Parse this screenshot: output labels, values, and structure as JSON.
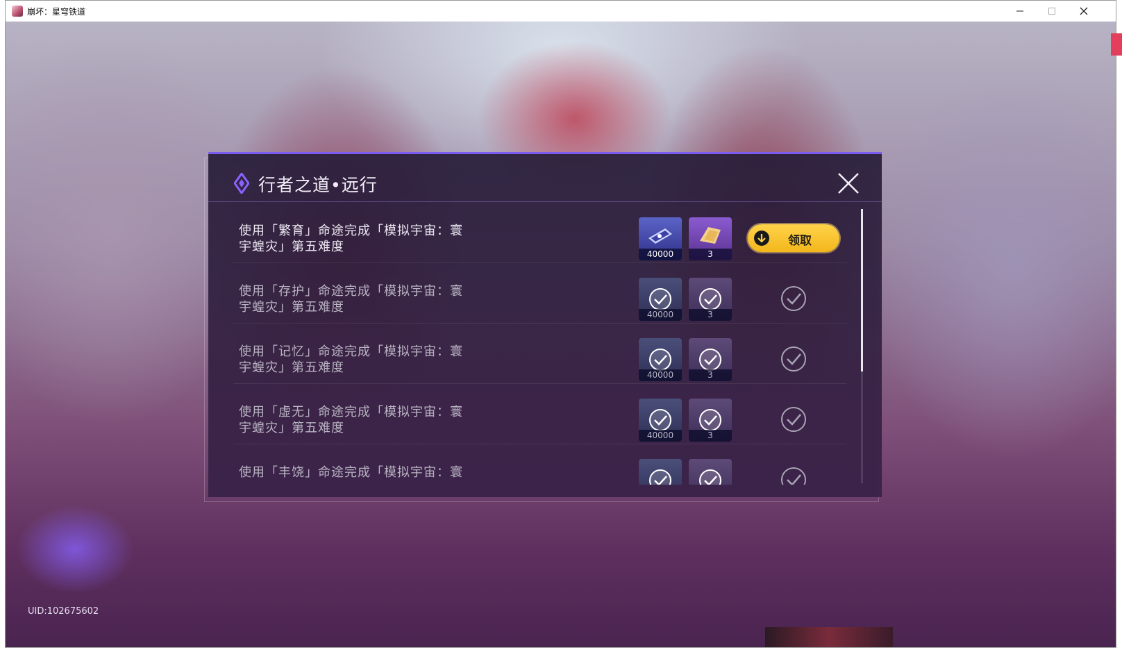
{
  "window": {
    "title": "崩坏：星穹铁道",
    "controls": [
      "minimize",
      "maximize",
      "close"
    ]
  },
  "dialog": {
    "title": "行者之道•远行",
    "close_icon": "close-x-icon"
  },
  "rows": [
    {
      "text_line1": "使用「繁育」命途完成「模拟宇宙：寰",
      "text_line2": "宇蝗灾」第五难度",
      "reward1_count": "40000",
      "reward2_count": "3",
      "status": "claimable",
      "claim_label": "领取"
    },
    {
      "text_line1": "使用「存护」命途完成「模拟宇宙：寰",
      "text_line2": "宇蝗灾」第五难度",
      "reward1_count": "40000",
      "reward2_count": "3",
      "status": "claimed"
    },
    {
      "text_line1": "使用「记忆」命途完成「模拟宇宙：寰",
      "text_line2": "宇蝗灾」第五难度",
      "reward1_count": "40000",
      "reward2_count": "3",
      "status": "claimed"
    },
    {
      "text_line1": "使用「虚无」命途完成「模拟宇宙：寰",
      "text_line2": "宇蝗灾」第五难度",
      "reward1_count": "40000",
      "reward2_count": "3",
      "status": "claimed"
    },
    {
      "text_line1": "使用「丰饶」命途完成「模拟宇宙：寰",
      "text_line2": "",
      "reward1_count": "",
      "reward2_count": "",
      "status": "claimed"
    }
  ],
  "footer": {
    "uid": "UID:102675602"
  },
  "colors": {
    "accent_purple": "#7b5cf0",
    "claim_yellow": "#f3b71c"
  }
}
